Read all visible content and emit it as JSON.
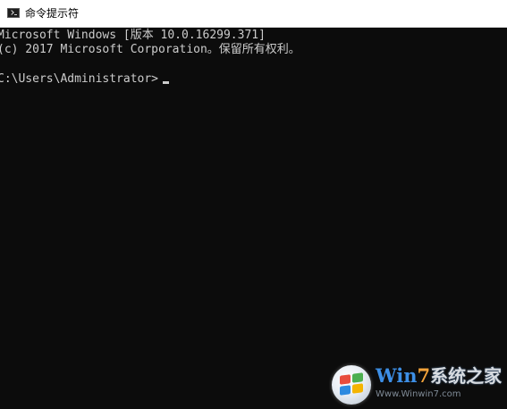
{
  "window": {
    "title": "命令提示符",
    "icon": "console-icon"
  },
  "console": {
    "lines": [
      "Microsoft Windows [版本 10.0.16299.371]",
      "(c) 2017 Microsoft Corporation。保留所有权利。"
    ],
    "prompt": "C:\\Users\\Administrator>",
    "colors": {
      "background": "#0c0c0c",
      "foreground": "#cccccc"
    }
  },
  "watermark": {
    "brand_win": "Win",
    "brand_seven": "7",
    "brand_cn": "系统之家",
    "url": "Www.Winwin7.com"
  }
}
